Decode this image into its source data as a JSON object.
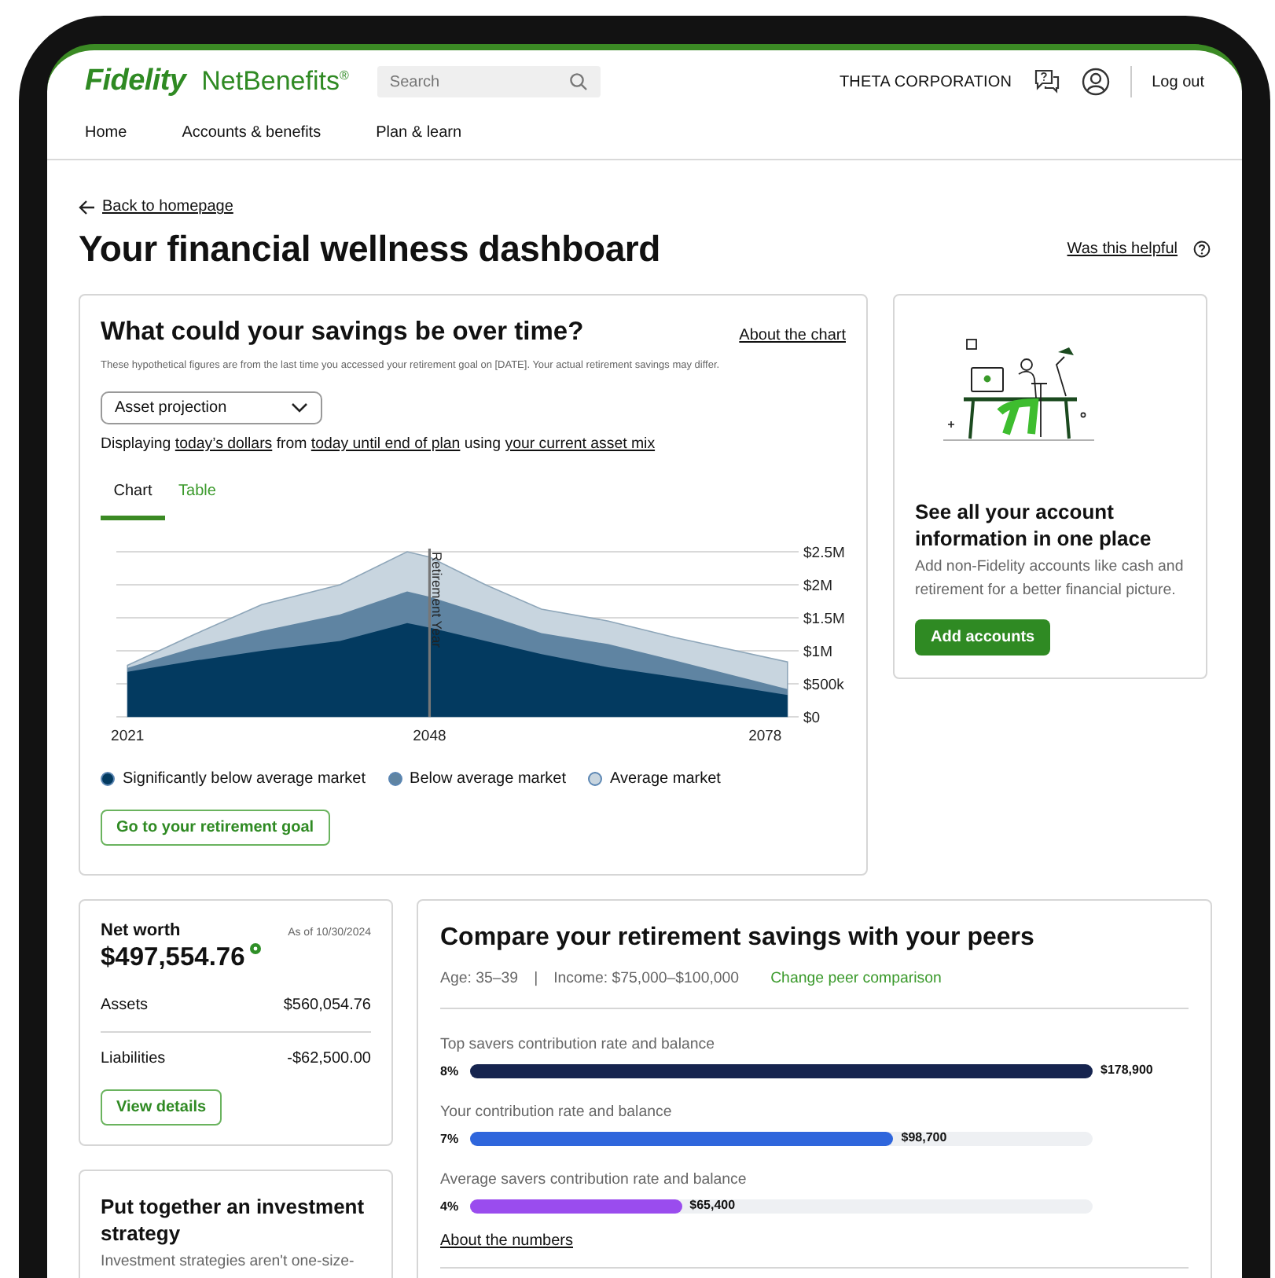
{
  "header": {
    "logo": "Fidelity",
    "product": "NetBenefits$^{®}$",
    "search": {
      "placeholder": "Search"
    },
    "company": "THETA CORPORATION",
    "logout": "Log out"
  },
  "nav": [
    {
      "label": "Home"
    },
    {
      "label": "Accounts & benefits"
    },
    {
      "label": "Plan & learn"
    }
  ],
  "back_link": "Back to homepage",
  "page_title": "Your financial wellness dashboard",
  "helpful_link": "Was this helpful",
  "projection_card": {
    "title": "What could your savings be over time?",
    "about_link": "About the chart",
    "disclaimer": "These hypothetical figures are from the last time you accessed your retirement goal on [DATE]. Your actual retirement savings may differ.",
    "dropdown": {
      "value": "Asset projection"
    },
    "display_line": [
      {
        "kind": "text",
        "text": "Displaying "
      },
      {
        "kind": "link",
        "text": "today’s dollars"
      },
      {
        "kind": "text",
        "text": " from "
      },
      {
        "kind": "link",
        "text": "today until end of plan"
      },
      {
        "kind": "text",
        "text": " using "
      },
      {
        "kind": "link",
        "text": "your current asset mix"
      }
    ],
    "tabs": [
      {
        "label": "Chart",
        "selected": true
      },
      {
        "label": "Table",
        "selected": false
      }
    ],
    "chart_data": {
      "type": "area",
      "grid": true,
      "x": [
        2021,
        2027,
        2033,
        2040,
        2046,
        2048,
        2053,
        2058,
        2064,
        2070,
        2080
      ],
      "xlim": [
        2020,
        2081
      ],
      "ylim": [
        0,
        2500000
      ],
      "xticks": [
        2021,
        2048,
        2078
      ],
      "yticks": [
        {
          "value": 0,
          "label": "$0"
        },
        {
          "value": 500000,
          "label": "$500k"
        },
        {
          "value": 1000000,
          "label": "$1M"
        },
        {
          "value": 1500000,
          "label": "$1.5M"
        },
        {
          "value": 2000000,
          "label": "$2M"
        },
        {
          "value": 2500000,
          "label": "$2.5M"
        }
      ],
      "series": [
        {
          "name": "Average market",
          "color": "#c8d5df",
          "values": [
            780000,
            1250000,
            1700000,
            2000000,
            2500000,
            2420000,
            2000000,
            1630000,
            1450000,
            1200000,
            830000
          ]
        },
        {
          "name": "Below average market",
          "color": "#5f84a2",
          "values": [
            740000,
            1050000,
            1300000,
            1550000,
            1900000,
            1820000,
            1550000,
            1270000,
            1100000,
            850000,
            420000
          ]
        },
        {
          "name": "Significantly below average market",
          "color": "#033a60",
          "values": [
            680000,
            850000,
            1000000,
            1150000,
            1420000,
            1350000,
            1150000,
            950000,
            750000,
            600000,
            330000
          ]
        }
      ],
      "ref_lines": [
        {
          "axis": "x",
          "value": 2048,
          "label": "Retirement Year"
        }
      ]
    },
    "button": "Go to your retirement goal"
  },
  "accounts_card": {
    "title": "See all your account information in one place",
    "text": "Add non-Fidelity accounts like cash and retirement for a better financial picture.",
    "button": "Add accounts"
  },
  "net_worth": {
    "label": "Net worth",
    "as_of": "As of 10/30/2024",
    "amount": "$497,554.76",
    "rows": [
      {
        "label": "Assets",
        "value": "$560,054.76"
      },
      {
        "label": "Liabilities",
        "value": "-$62,500.00"
      }
    ],
    "button": "View details"
  },
  "strategy_card": {
    "title": "Put together an investment strategy",
    "text": "Investment strategies aren't one-size-"
  },
  "peers": {
    "title": "Compare your retirement savings with your peers",
    "age": "Age: 35–39",
    "separator": "|",
    "income": "Income: $75,000–$100,000",
    "change_link": "Change peer comparison",
    "bars": [
      {
        "label": "Top savers contribution rate and balance",
        "rate": "8%",
        "amount": "$178,900",
        "level": 1.0,
        "color": "#16244f"
      },
      {
        "label": "Your contribution rate and balance",
        "rate": "7%",
        "amount": "$98,700",
        "level": 0.68,
        "color": "#2f66dc"
      },
      {
        "label": "Average savers contribution rate and balance",
        "rate": "4%",
        "amount": "$65,400",
        "level": 0.34,
        "color": "#9a4cee"
      }
    ],
    "about_link": "About the numbers"
  }
}
